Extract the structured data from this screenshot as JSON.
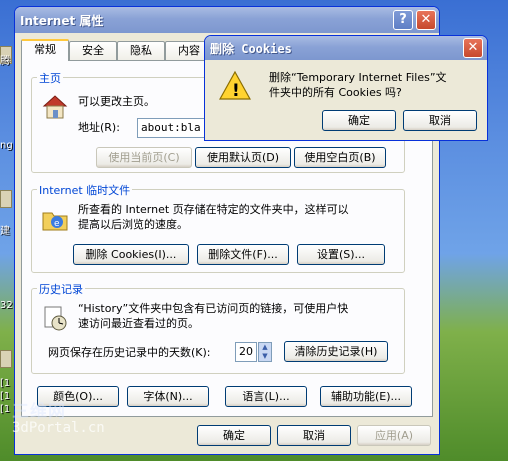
{
  "desktop": {
    "left_icon_labels": [
      "腾",
      "ng",
      "建",
      "32",
      "[1",
      "[1",
      "[1"
    ],
    "watermark": [
      "三维网",
      "3dPortal.cn"
    ]
  },
  "window": {
    "title": "Internet 属性",
    "help_glyph": "?",
    "close_glyph": "✕",
    "tabs": [
      "常规",
      "安全",
      "隐私",
      "内容"
    ],
    "active_tab": "常规",
    "homepage": {
      "title": "主页",
      "description": "可以更改主页。",
      "address_label": "地址(R):",
      "address_value": "about:bla",
      "use_current": "使用当前页(C)",
      "use_default": "使用默认页(D)",
      "use_blank": "使用空白页(B)"
    },
    "temp_files": {
      "title": "Internet 临时文件",
      "line1": "所查看的 Internet 页存储在特定的文件夹中，这样可以",
      "line2": "提高以后浏览的速度。",
      "delete_cookies": "删除 Cookies(I)...",
      "delete_files": "删除文件(F)...",
      "settings": "设置(S)..."
    },
    "history": {
      "title": "历史记录",
      "line1": "“History”文件夹中包含有已访问页的链接，可使用户快",
      "line2": "速访问最近查看过的页。",
      "days_label": "网页保存在历史记录中的天数(K):",
      "days_value": "20",
      "clear_history": "清除历史记录(H)"
    },
    "bottom_buttons": {
      "colors": "颜色(O)...",
      "fonts": "字体(N)...",
      "languages": "语言(L)...",
      "accessibility": "辅助功能(E)..."
    },
    "footer": {
      "ok": "确定",
      "cancel": "取消",
      "apply": "应用(A)"
    }
  },
  "dialog": {
    "title": "删除 Cookies",
    "message_line1": "删除“Temporary Internet Files”文",
    "message_line2": "件夹中的所有 Cookies 吗?",
    "ok": "确定",
    "cancel": "取消",
    "icon_glyph": "!"
  },
  "colors": {
    "accent_title": "#0046d5",
    "dialog_border": "#0831d9",
    "button_border": "#003c74"
  }
}
